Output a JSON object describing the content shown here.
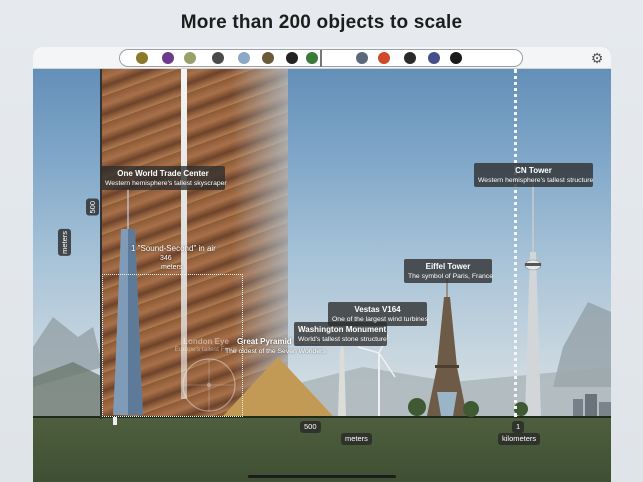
{
  "headline": "More than 200 objects to scale",
  "toolbar": {
    "settings_icon": "gear-icon",
    "scrubber_thumbs": [
      {
        "color": "#8a7a2a"
      },
      {
        "color": "#6b3b8a"
      },
      {
        "color": "#9aa06a"
      },
      {
        "color": "#4a4a4a"
      },
      {
        "color": "#8aa8c8"
      },
      {
        "color": "#6a5a3a"
      },
      {
        "color": "#222222"
      },
      {
        "color": "#3a7a3a"
      },
      {
        "color": "#5a6a7a"
      },
      {
        "color": "#d04a2a"
      },
      {
        "color": "#2a2a2a"
      },
      {
        "color": "#44508a"
      },
      {
        "color": "#1a1a1a"
      }
    ]
  },
  "axis": {
    "y_unit": "meters",
    "y_tick": "500",
    "x_tick_500": "500",
    "x_unit_meters": "meters",
    "x_tick_1": "1",
    "x_unit_km": "kilometers"
  },
  "objects": {
    "wtc": {
      "title": "One World Trade Center",
      "subtitle": "Western hemisphere's tallest skyscraper"
    },
    "sound": {
      "title": "1 \"Sound-Second\" in air",
      "value": "346",
      "unit": "meters"
    },
    "london_eye": {
      "title": "London Eye",
      "subtitle": "Europe's tallest Ferris"
    },
    "pyramid": {
      "title": "Great Pyramid of Giza",
      "subtitle": "The oldest of the Seven Wonders"
    },
    "washington": {
      "title": "Washington Monument",
      "subtitle": "World's tallest stone structure"
    },
    "vestas": {
      "title": "Vestas V164",
      "subtitle": "One of the largest wind turbines"
    },
    "eiffel": {
      "title": "Eiffel Tower",
      "subtitle": "The symbol of Paris, France"
    },
    "cn": {
      "title": "CN Tower",
      "subtitle": "Western hemisphere's tallest structure"
    }
  }
}
